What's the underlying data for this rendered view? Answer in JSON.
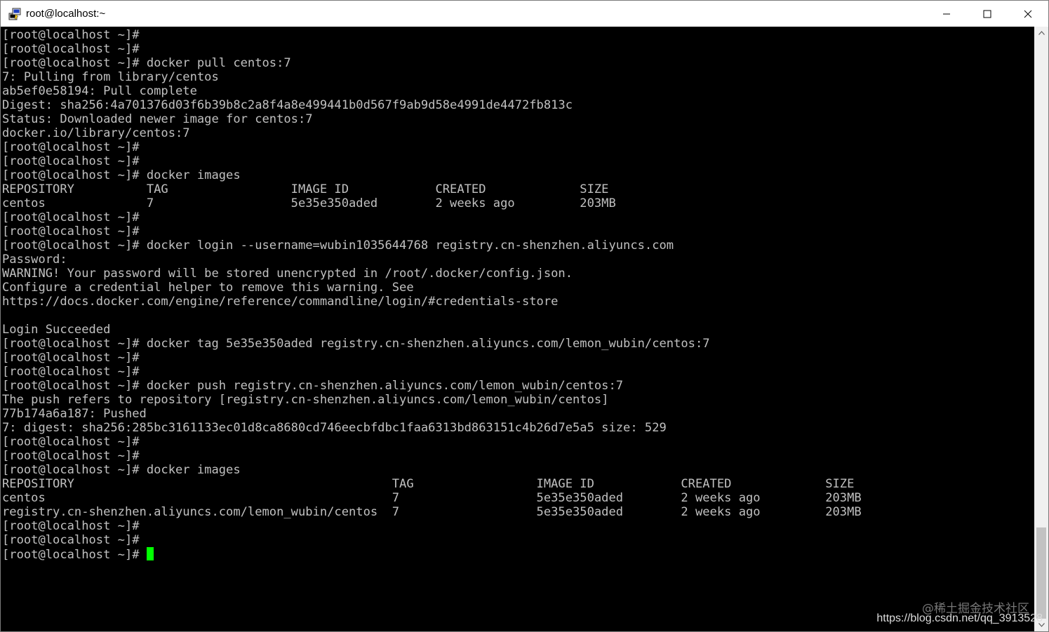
{
  "window": {
    "title": "root@localhost:~"
  },
  "terminal": {
    "lines": [
      "[root@localhost ~]#",
      "[root@localhost ~]#",
      "[root@localhost ~]# docker pull centos:7",
      "7: Pulling from library/centos",
      "ab5ef0e58194: Pull complete",
      "Digest: sha256:4a701376d03f6b39b8c2a8f4a8e499441b0d567f9ab9d58e4991de4472fb813c",
      "Status: Downloaded newer image for centos:7",
      "docker.io/library/centos:7",
      "[root@localhost ~]#",
      "[root@localhost ~]#",
      "[root@localhost ~]# docker images",
      "REPOSITORY          TAG                 IMAGE ID            CREATED             SIZE",
      "centos              7                   5e35e350aded        2 weeks ago         203MB",
      "[root@localhost ~]#",
      "[root@localhost ~]#",
      "[root@localhost ~]# docker login --username=wubin1035644768 registry.cn-shenzhen.aliyuncs.com",
      "Password:",
      "WARNING! Your password will be stored unencrypted in /root/.docker/config.json.",
      "Configure a credential helper to remove this warning. See",
      "https://docs.docker.com/engine/reference/commandline/login/#credentials-store",
      "",
      "Login Succeeded",
      "[root@localhost ~]# docker tag 5e35e350aded registry.cn-shenzhen.aliyuncs.com/lemon_wubin/centos:7",
      "[root@localhost ~]#",
      "[root@localhost ~]#",
      "[root@localhost ~]# docker push registry.cn-shenzhen.aliyuncs.com/lemon_wubin/centos:7",
      "The push refers to repository [registry.cn-shenzhen.aliyuncs.com/lemon_wubin/centos]",
      "77b174a6a187: Pushed",
      "7: digest: sha256:285bc3161133ec01d8ca8680cd746eecbfdbc1faa6313bd863151c4b26d7e5a5 size: 529",
      "[root@localhost ~]#",
      "[root@localhost ~]#",
      "[root@localhost ~]# docker images",
      "REPOSITORY                                            TAG                 IMAGE ID            CREATED             SIZE",
      "centos                                                7                   5e35e350aded        2 weeks ago         203MB",
      "registry.cn-shenzhen.aliyuncs.com/lemon_wubin/centos  7                   5e35e350aded        2 weeks ago         203MB",
      "[root@localhost ~]#",
      "[root@localhost ~]#"
    ],
    "prompt": "[root@localhost ~]# "
  },
  "watermark": {
    "line1": "@稀土掘金技术社区",
    "line2": "https://blog.csdn.net/qq_3913528"
  },
  "colors": {
    "background": "#000000",
    "text": "#c0c0c0",
    "cursor": "#00ff00"
  },
  "icons": {
    "app": "putty-icon",
    "minimize": "minimize-icon",
    "maximize": "maximize-icon",
    "close": "close-icon"
  },
  "scrollbar": {
    "position_fraction": 1.0
  }
}
